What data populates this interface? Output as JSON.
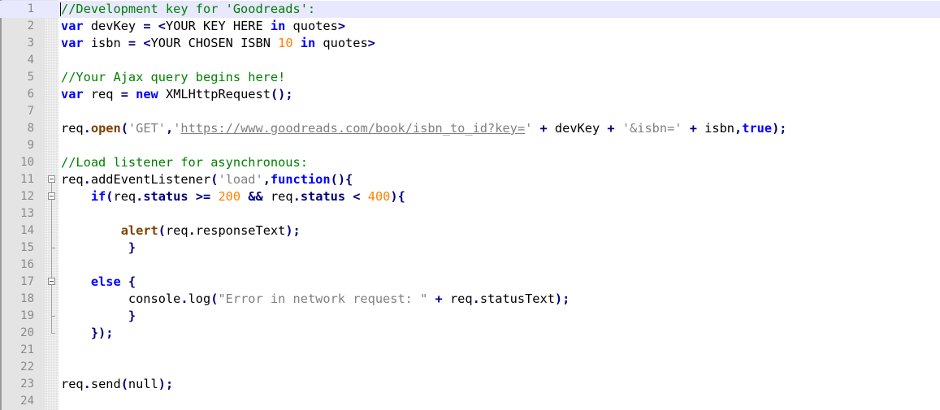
{
  "editor": {
    "current_line": 1,
    "lines": [
      {
        "number": "1",
        "tokens": [
          {
            "t": "//Development key for 'Goodreads':",
            "c": "comment"
          }
        ]
      },
      {
        "number": "2",
        "tokens": [
          {
            "t": "var",
            "c": "keyword"
          },
          {
            "t": " devKey ",
            "c": "plain"
          },
          {
            "t": "=",
            "c": "operator"
          },
          {
            "t": " ",
            "c": "plain"
          },
          {
            "t": "<",
            "c": "operator"
          },
          {
            "t": "YOUR KEY HERE ",
            "c": "plain"
          },
          {
            "t": "in",
            "c": "keyword"
          },
          {
            "t": " quotes",
            "c": "plain"
          },
          {
            "t": ">",
            "c": "operator"
          }
        ]
      },
      {
        "number": "3",
        "tokens": [
          {
            "t": "var",
            "c": "keyword"
          },
          {
            "t": " isbn ",
            "c": "plain"
          },
          {
            "t": "=",
            "c": "operator"
          },
          {
            "t": " ",
            "c": "plain"
          },
          {
            "t": "<",
            "c": "operator"
          },
          {
            "t": "YOUR CHOSEN ISBN ",
            "c": "plain"
          },
          {
            "t": "10",
            "c": "number"
          },
          {
            "t": " ",
            "c": "plain"
          },
          {
            "t": "in",
            "c": "keyword"
          },
          {
            "t": " quotes",
            "c": "plain"
          },
          {
            "t": ">",
            "c": "operator"
          }
        ]
      },
      {
        "number": "4",
        "tokens": []
      },
      {
        "number": "5",
        "tokens": [
          {
            "t": "//Your Ajax query begins here!",
            "c": "comment"
          }
        ]
      },
      {
        "number": "6",
        "tokens": [
          {
            "t": "var",
            "c": "keyword"
          },
          {
            "t": " req ",
            "c": "plain"
          },
          {
            "t": "=",
            "c": "operator"
          },
          {
            "t": " ",
            "c": "plain"
          },
          {
            "t": "new",
            "c": "keyword"
          },
          {
            "t": " XMLHttpRequest",
            "c": "plain"
          },
          {
            "t": "();",
            "c": "operator"
          }
        ]
      },
      {
        "number": "7",
        "tokens": []
      },
      {
        "number": "8",
        "tokens": [
          {
            "t": "req",
            "c": "plain"
          },
          {
            "t": ".",
            "c": "operator"
          },
          {
            "t": "open",
            "c": "method"
          },
          {
            "t": "(",
            "c": "operator"
          },
          {
            "t": "'GET'",
            "c": "string"
          },
          {
            "t": ",",
            "c": "operator"
          },
          {
            "t": "'",
            "c": "string"
          },
          {
            "t": "https://www.goodreads.com/book/isbn_to_id?key=",
            "c": "link"
          },
          {
            "t": "'",
            "c": "string"
          },
          {
            "t": " ",
            "c": "plain"
          },
          {
            "t": "+",
            "c": "operator"
          },
          {
            "t": " devKey ",
            "c": "plain"
          },
          {
            "t": "+",
            "c": "operator"
          },
          {
            "t": " ",
            "c": "plain"
          },
          {
            "t": "'&isbn='",
            "c": "string"
          },
          {
            "t": " ",
            "c": "plain"
          },
          {
            "t": "+",
            "c": "operator"
          },
          {
            "t": " isbn",
            "c": "plain"
          },
          {
            "t": ",",
            "c": "operator"
          },
          {
            "t": "true",
            "c": "keyword"
          },
          {
            "t": ");",
            "c": "operator"
          }
        ]
      },
      {
        "number": "9",
        "tokens": []
      },
      {
        "number": "10",
        "tokens": [
          {
            "t": "//Load listener for asynchronous:",
            "c": "comment"
          }
        ]
      },
      {
        "number": "11",
        "tokens": [
          {
            "t": "req",
            "c": "plain"
          },
          {
            "t": ".",
            "c": "operator"
          },
          {
            "t": "addEventListener",
            "c": "plain"
          },
          {
            "t": "(",
            "c": "operator"
          },
          {
            "t": "'load'",
            "c": "string"
          },
          {
            "t": ",",
            "c": "operator"
          },
          {
            "t": "function",
            "c": "keyword"
          },
          {
            "t": "(){",
            "c": "operator"
          }
        ]
      },
      {
        "number": "12",
        "tokens": [
          {
            "t": "    ",
            "c": "plain"
          },
          {
            "t": "if",
            "c": "keyword"
          },
          {
            "t": "(",
            "c": "operator"
          },
          {
            "t": "req",
            "c": "plain"
          },
          {
            "t": ".",
            "c": "operator"
          },
          {
            "t": "status",
            "c": "type"
          },
          {
            "t": " ",
            "c": "plain"
          },
          {
            "t": ">=",
            "c": "operator"
          },
          {
            "t": " ",
            "c": "plain"
          },
          {
            "t": "200",
            "c": "number"
          },
          {
            "t": " ",
            "c": "plain"
          },
          {
            "t": "&&",
            "c": "operator"
          },
          {
            "t": " req",
            "c": "plain"
          },
          {
            "t": ".",
            "c": "operator"
          },
          {
            "t": "status",
            "c": "type"
          },
          {
            "t": " ",
            "c": "plain"
          },
          {
            "t": "<",
            "c": "operator"
          },
          {
            "t": " ",
            "c": "plain"
          },
          {
            "t": "400",
            "c": "number"
          },
          {
            "t": "){",
            "c": "operator"
          }
        ]
      },
      {
        "number": "13",
        "tokens": []
      },
      {
        "number": "14",
        "tokens": [
          {
            "t": "        ",
            "c": "plain"
          },
          {
            "t": "alert",
            "c": "method"
          },
          {
            "t": "(",
            "c": "operator"
          },
          {
            "t": "req",
            "c": "plain"
          },
          {
            "t": ".",
            "c": "operator"
          },
          {
            "t": "responseText",
            "c": "plain"
          },
          {
            "t": ");",
            "c": "operator"
          }
        ]
      },
      {
        "number": "15",
        "tokens": [
          {
            "t": "         ",
            "c": "plain"
          },
          {
            "t": "}",
            "c": "operator"
          }
        ]
      },
      {
        "number": "16",
        "tokens": []
      },
      {
        "number": "17",
        "tokens": [
          {
            "t": "    ",
            "c": "plain"
          },
          {
            "t": "else",
            "c": "keyword"
          },
          {
            "t": " ",
            "c": "plain"
          },
          {
            "t": "{",
            "c": "operator"
          }
        ]
      },
      {
        "number": "18",
        "tokens": [
          {
            "t": "         console",
            "c": "plain"
          },
          {
            "t": ".",
            "c": "operator"
          },
          {
            "t": "log",
            "c": "plain"
          },
          {
            "t": "(",
            "c": "operator"
          },
          {
            "t": "\"Error in network request: \"",
            "c": "string"
          },
          {
            "t": " ",
            "c": "plain"
          },
          {
            "t": "+",
            "c": "operator"
          },
          {
            "t": " req",
            "c": "plain"
          },
          {
            "t": ".",
            "c": "operator"
          },
          {
            "t": "statusText",
            "c": "plain"
          },
          {
            "t": ");",
            "c": "operator"
          }
        ]
      },
      {
        "number": "19",
        "tokens": [
          {
            "t": "         ",
            "c": "plain"
          },
          {
            "t": "}",
            "c": "operator"
          }
        ]
      },
      {
        "number": "20",
        "tokens": [
          {
            "t": "    ",
            "c": "plain"
          },
          {
            "t": "});",
            "c": "operator"
          }
        ]
      },
      {
        "number": "21",
        "tokens": []
      },
      {
        "number": "22",
        "tokens": []
      },
      {
        "number": "23",
        "tokens": [
          {
            "t": "req",
            "c": "plain"
          },
          {
            "t": ".",
            "c": "operator"
          },
          {
            "t": "send",
            "c": "plain"
          },
          {
            "t": "(",
            "c": "operator"
          },
          {
            "t": "null",
            "c": "plain"
          },
          {
            "t": ");",
            "c": "operator"
          }
        ]
      },
      {
        "number": "24",
        "tokens": []
      }
    ]
  },
  "colors": {
    "comment": "#008000",
    "keyword": "#0000ff",
    "operator": "#000080",
    "number": "#ff8000",
    "string": "#808080",
    "method": "#804000",
    "gutter_background": "#e4e4e4",
    "current_line_background": "#e8e8ff"
  },
  "fold_markers": {
    "11": "fold-open-icon",
    "12": "fold-open-icon",
    "15": "fold-end-icon",
    "17": "fold-open-icon",
    "19": "fold-end-icon",
    "20": "fold-end-icon"
  }
}
